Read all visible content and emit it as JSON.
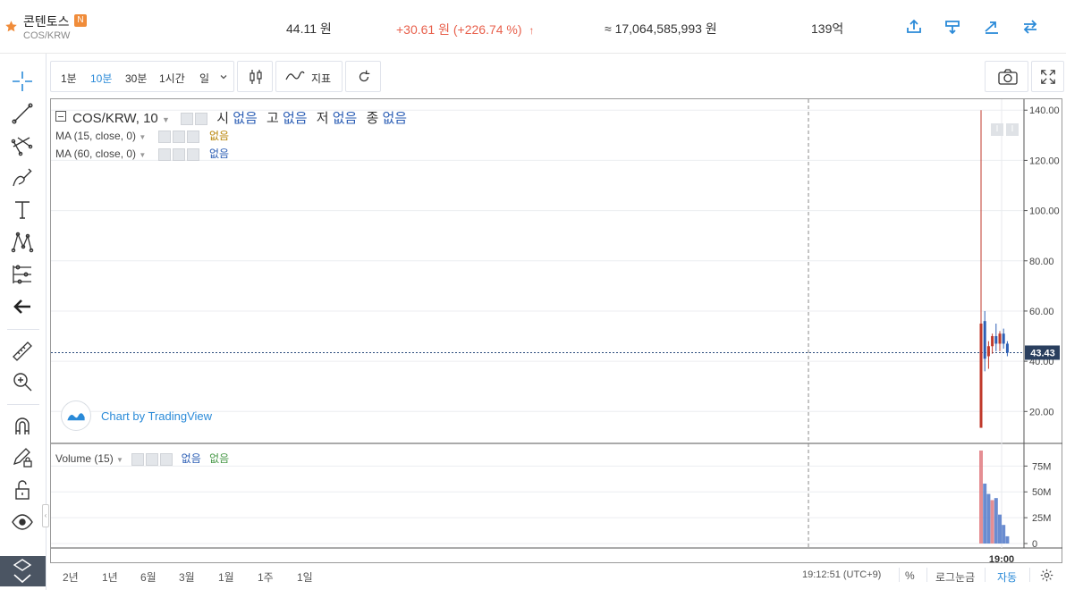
{
  "header": {
    "coin_name": "콘텐토스",
    "new_badge": "N",
    "pair": "COS/KRW",
    "price": "44.11 원",
    "change": "+30.61 원 (+226.74 %)",
    "change_arrow": "↑",
    "volume_krw": "≈ 17,064,585,993 원",
    "market_cap": "139억",
    "accent_color": "#e8604c",
    "icon_color": "#2a8ad8",
    "icons": [
      "export-icon",
      "download-icon",
      "trend-icon",
      "swap-icon"
    ]
  },
  "toolbar": {
    "intervals": [
      "1분",
      "10분",
      "30분",
      "1시간",
      "일"
    ],
    "active_interval": "10분",
    "indicators_label": "지표"
  },
  "legend": {
    "symbol": "COS/KRW, 10",
    "ohlc": [
      {
        "label": "시",
        "value": "없음"
      },
      {
        "label": "고",
        "value": "없음"
      },
      {
        "label": "저",
        "value": "없음"
      },
      {
        "label": "종",
        "value": "없음"
      }
    ],
    "ma15": "MA (15, close, 0)",
    "ma60": "MA (60, close, 0)",
    "ma_value": "없음",
    "volume": "Volume (15)",
    "volume_values": [
      "없음",
      "없음"
    ],
    "watermark": "Chart by TradingView"
  },
  "chart_data": {
    "type": "candlestick",
    "price_axis": {
      "ticks": [
        140,
        120,
        100,
        80,
        60,
        40,
        20
      ],
      "tick_labels": [
        "140.00",
        "120.00",
        "100.00",
        "80.00",
        "60.00",
        "40.00",
        "20.00"
      ],
      "ylim": [
        8,
        144
      ]
    },
    "last_price": "43.43",
    "time_axis": {
      "tick_labels": [
        "19:00"
      ]
    },
    "volume_axis": {
      "ticks": [
        75,
        50,
        25,
        0
      ],
      "tick_labels": [
        "75M",
        "50M",
        "25M",
        "0"
      ],
      "ylim": [
        0,
        90
      ]
    },
    "candles": [
      {
        "open": 13.5,
        "high": 140,
        "low": 13.5,
        "close": 55,
        "color": "up"
      },
      {
        "open": 56,
        "high": 60,
        "low": 36,
        "close": 41,
        "color": "down"
      },
      {
        "open": 42,
        "high": 48,
        "low": 37,
        "close": 46,
        "color": "up"
      },
      {
        "open": 46,
        "high": 51,
        "low": 43,
        "close": 50,
        "color": "up"
      },
      {
        "open": 50,
        "high": 55,
        "low": 44,
        "close": 47,
        "color": "down"
      },
      {
        "open": 47,
        "high": 52,
        "low": 44,
        "close": 51,
        "color": "up"
      },
      {
        "open": 51,
        "high": 53,
        "low": 45,
        "close": 47,
        "color": "down"
      },
      {
        "open": 47,
        "high": 48,
        "low": 42,
        "close": 43.4,
        "color": "down"
      }
    ],
    "volumes": [
      {
        "value": 90,
        "color": "up"
      },
      {
        "value": 58,
        "color": "down"
      },
      {
        "value": 48,
        "color": "down"
      },
      {
        "value": 42,
        "color": "up"
      },
      {
        "value": 44,
        "color": "down"
      },
      {
        "value": 28,
        "color": "down"
      },
      {
        "value": 18,
        "color": "down"
      },
      {
        "value": 7,
        "color": "down"
      }
    ],
    "up_color": "#c0392b",
    "down_color": "#2d5fb5"
  },
  "bottom": {
    "ranges": [
      "2년",
      "1년",
      "6월",
      "3월",
      "1월",
      "1주",
      "1일"
    ],
    "time": "19:12:51 (UTC+9)",
    "percent": "%",
    "log": "로그눈금",
    "auto": "자동"
  }
}
